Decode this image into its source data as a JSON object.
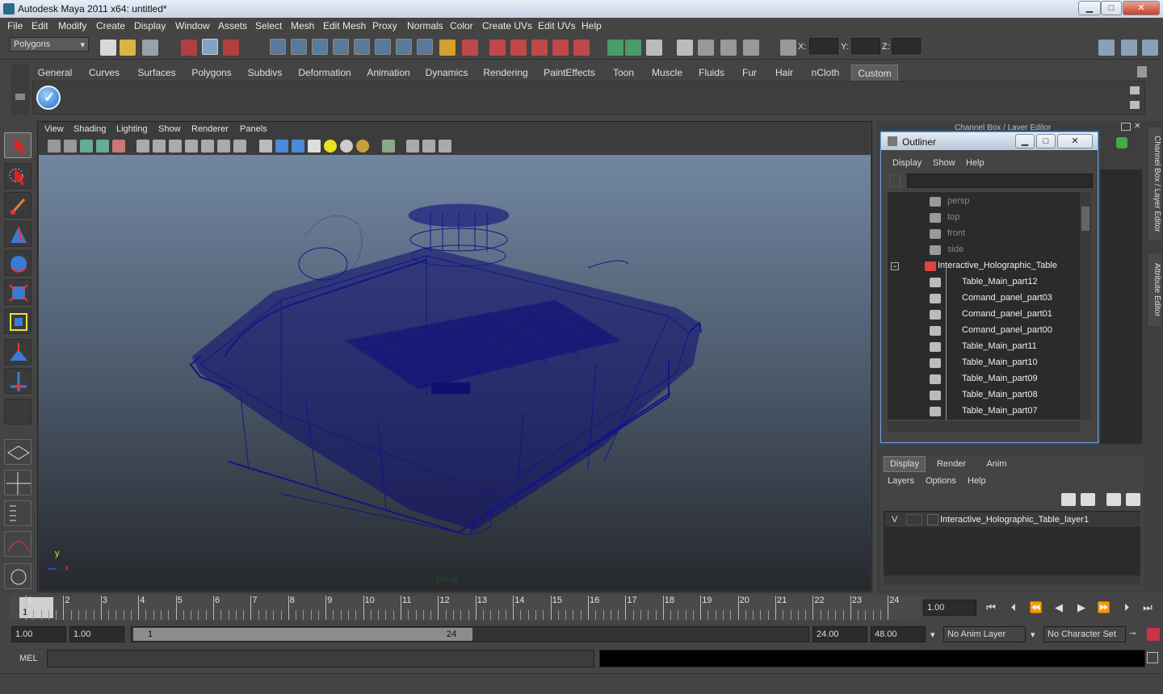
{
  "window": {
    "title": "Autodesk Maya 2011 x64: untitled*",
    "min": "▁",
    "max": "□",
    "close": "✕"
  },
  "menu": [
    "File",
    "Edit",
    "Modify",
    "Create",
    "Display",
    "Window",
    "Assets",
    "Select",
    "Mesh",
    "Edit Mesh",
    "Proxy",
    "Normals",
    "Color",
    "Create UVs",
    "Edit UVs",
    "Help"
  ],
  "status": {
    "mode": "Polygons",
    "x_label": "X:",
    "y_label": "Y:",
    "z_label": "Z:"
  },
  "shelf": {
    "tabs": [
      "General",
      "Curves",
      "Surfaces",
      "Polygons",
      "Subdivs",
      "Deformation",
      "Animation",
      "Dynamics",
      "Rendering",
      "PaintEffects",
      "Toon",
      "Muscle",
      "Fluids",
      "Fur",
      "Hair",
      "nCloth",
      "Custom"
    ],
    "active": "Custom"
  },
  "viewport": {
    "menu": [
      "View",
      "Shading",
      "Lighting",
      "Show",
      "Renderer",
      "Panels"
    ],
    "camera": "persp",
    "axis_y": "y",
    "axis_x": "x"
  },
  "dock": {
    "title": "Channel Box / Layer Editor",
    "side_tab_1": "Channel Box / Layer Editor",
    "side_tab_2": "Attribute Editor"
  },
  "outliner": {
    "title": "Outliner",
    "menu": [
      "Display",
      "Show",
      "Help"
    ],
    "items": [
      {
        "label": "persp",
        "dim": true
      },
      {
        "label": "top",
        "dim": true
      },
      {
        "label": "front",
        "dim": true
      },
      {
        "label": "side",
        "dim": true
      },
      {
        "label": "Interactive_Holographic_Table",
        "dim": false,
        "group": true
      },
      {
        "label": "Table_Main_part12"
      },
      {
        "label": "Comand_panel_part03"
      },
      {
        "label": "Comand_panel_part01"
      },
      {
        "label": "Comand_panel_part00"
      },
      {
        "label": "Table_Main_part11"
      },
      {
        "label": "Table_Main_part10"
      },
      {
        "label": "Table_Main_part09"
      },
      {
        "label": "Table_Main_part08"
      },
      {
        "label": "Table_Main_part07"
      }
    ]
  },
  "layers": {
    "tabs": [
      "Display",
      "Render",
      "Anim"
    ],
    "active": "Display",
    "menu": [
      "Layers",
      "Options",
      "Help"
    ],
    "layer": {
      "visible": "V",
      "name": "Interactive_Holographic_Table_layer1"
    }
  },
  "timeline": {
    "ticks": [
      "1",
      "2",
      "3",
      "4",
      "5",
      "6",
      "7",
      "8",
      "9",
      "10",
      "11",
      "12",
      "13",
      "14",
      "15",
      "16",
      "17",
      "18",
      "19",
      "20",
      "21",
      "22",
      "23",
      "24"
    ],
    "current_frame": "1.00",
    "playhead": "1"
  },
  "range": {
    "start": "1.00",
    "start2": "1.00",
    "slider_start": "1",
    "slider_end": "24",
    "end": "24.00",
    "end2": "48.00",
    "anim_layer": "No Anim Layer",
    "char_set": "No Character Set"
  },
  "mel": {
    "label": "MEL"
  }
}
